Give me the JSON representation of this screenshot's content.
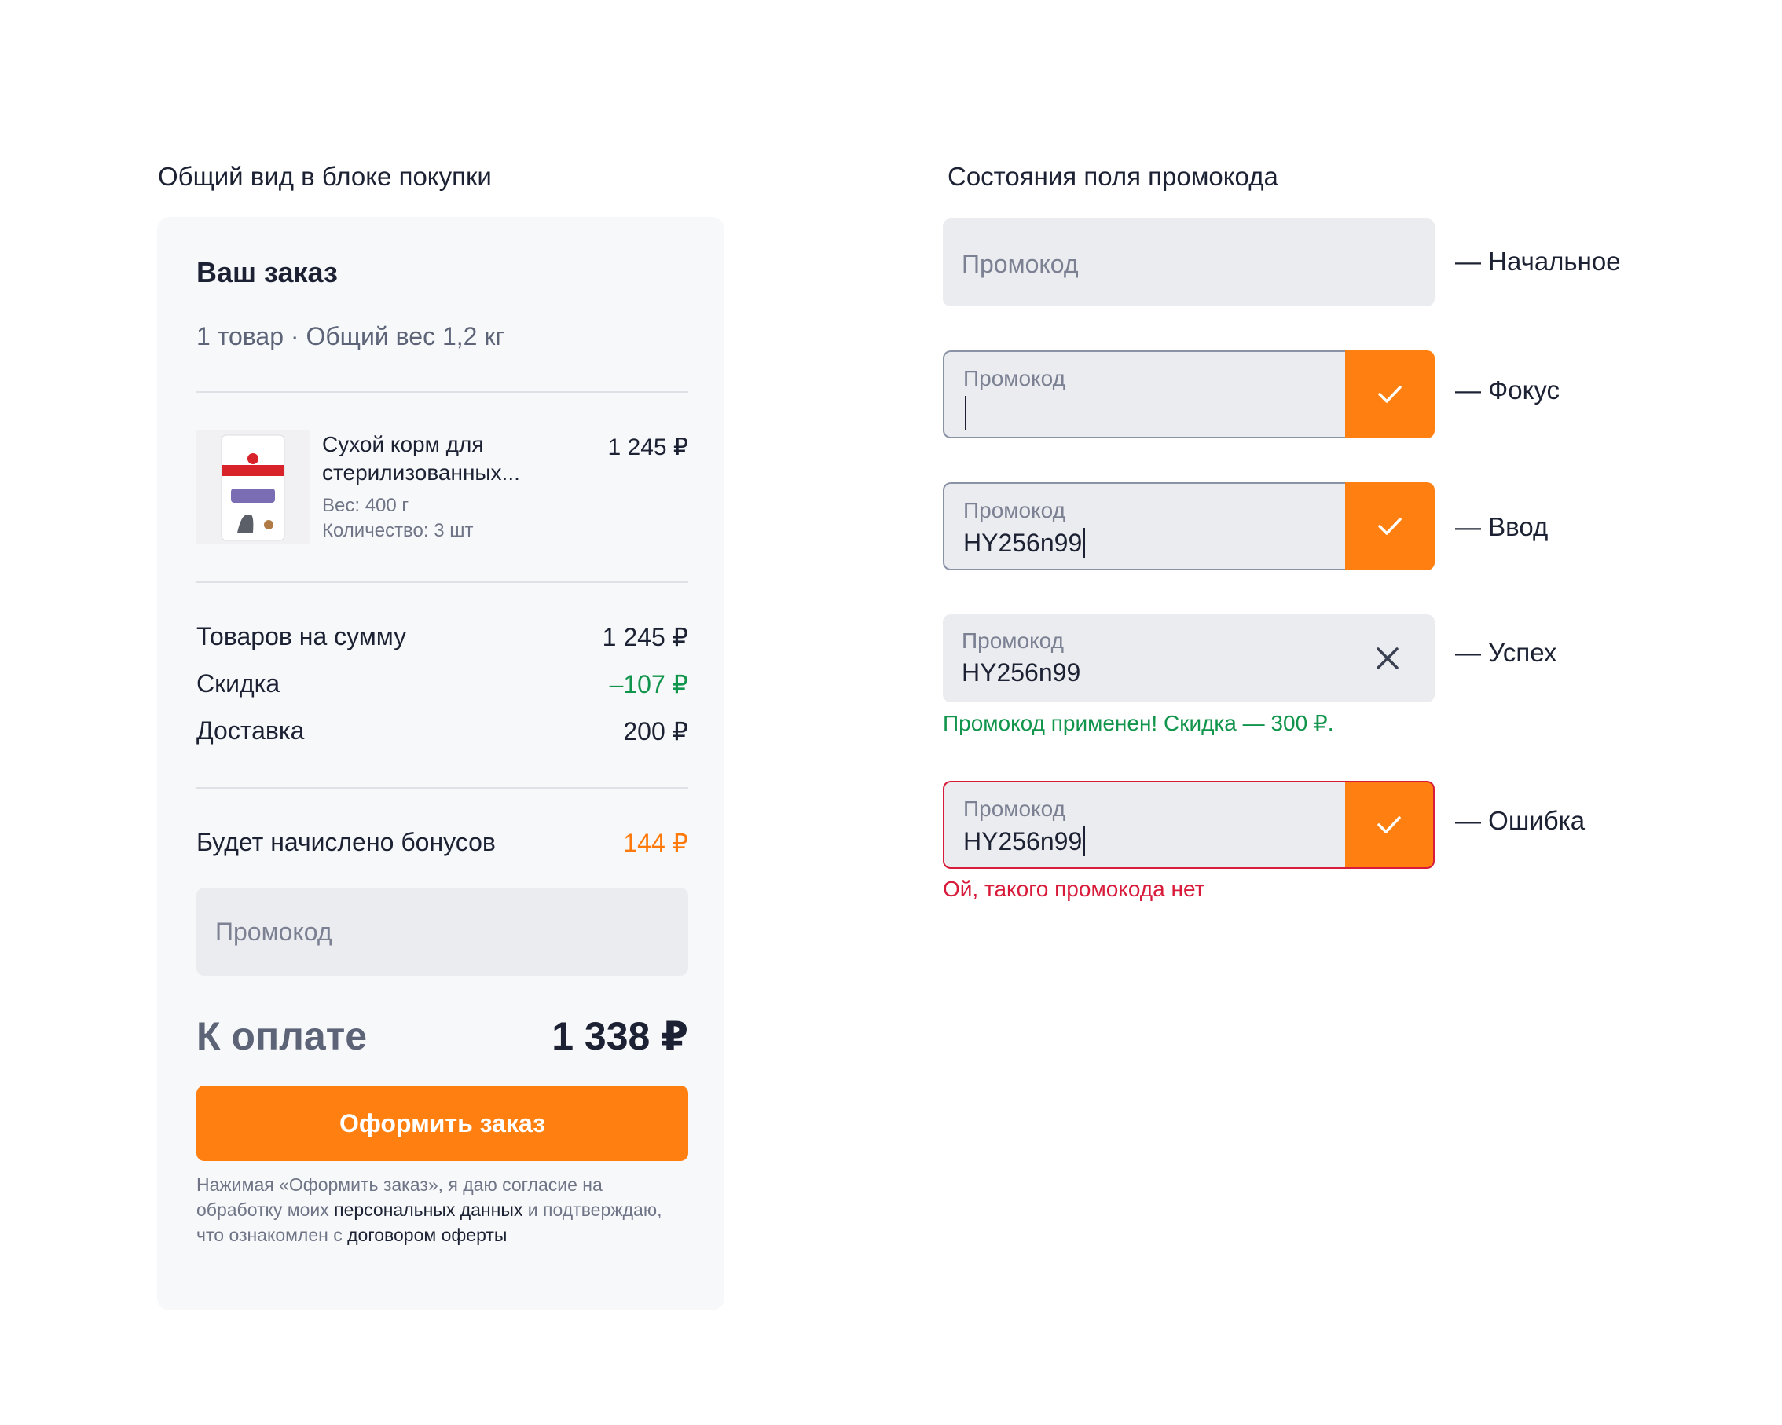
{
  "left_section": {
    "title": "Общий вид в блоке покупки"
  },
  "right_section": {
    "title": "Состояния поля промокода"
  },
  "order": {
    "title": "Ваш заказ",
    "subtitle": "1 товар · Общий вес 1,2 кг",
    "product": {
      "name_line1": "Сухой корм для",
      "name_line2": "стерилизованных...",
      "weight": "Вес: 400 г",
      "quantity": "Количество: 3 шт",
      "price": "1 245 ₽"
    },
    "summary": [
      {
        "label": "Товаров на сумму",
        "value": "1 245 ₽"
      },
      {
        "label": "Скидка",
        "value": "–107 ₽"
      },
      {
        "label": "Доставка",
        "value": "200 ₽"
      }
    ],
    "bonus": {
      "label": "Будет начислено бонусов",
      "value": "144 ₽"
    },
    "promo_placeholder": "Промокод",
    "total": {
      "label": "К оплате",
      "value": "1 338 ₽"
    },
    "checkout_label": "Оформить заказ",
    "consent": {
      "part1": "Нажимая «Оформить заказ», я даю согласие на обработку моих ",
      "link1": "персональных данных",
      "part2": " и подтверждаю, что ознакомлен с ",
      "link2": "договором оферты"
    }
  },
  "colors": {
    "accent": "#ff8010",
    "success": "#11944b",
    "error": "#d81b3a",
    "field_bg": "#ebecef"
  },
  "icons": {
    "apply": "check-icon",
    "clear": "close-icon"
  },
  "states": {
    "initial": {
      "placeholder": "Промокод",
      "label": "— Начальное"
    },
    "focus": {
      "field_label": "Промокод",
      "value": "",
      "label": "— Фокус"
    },
    "input": {
      "field_label": "Промокод",
      "value": "HY256n99",
      "label": "— Ввод"
    },
    "success": {
      "field_label": "Промокод",
      "value": "HY256n99",
      "label": "— Успех",
      "message": "Промокод применен! Скидка — 300 ₽."
    },
    "error": {
      "field_label": "Промокод",
      "value": "HY256n99",
      "label": "— Ошибка",
      "message": "Ой, такого промокода нет"
    }
  }
}
